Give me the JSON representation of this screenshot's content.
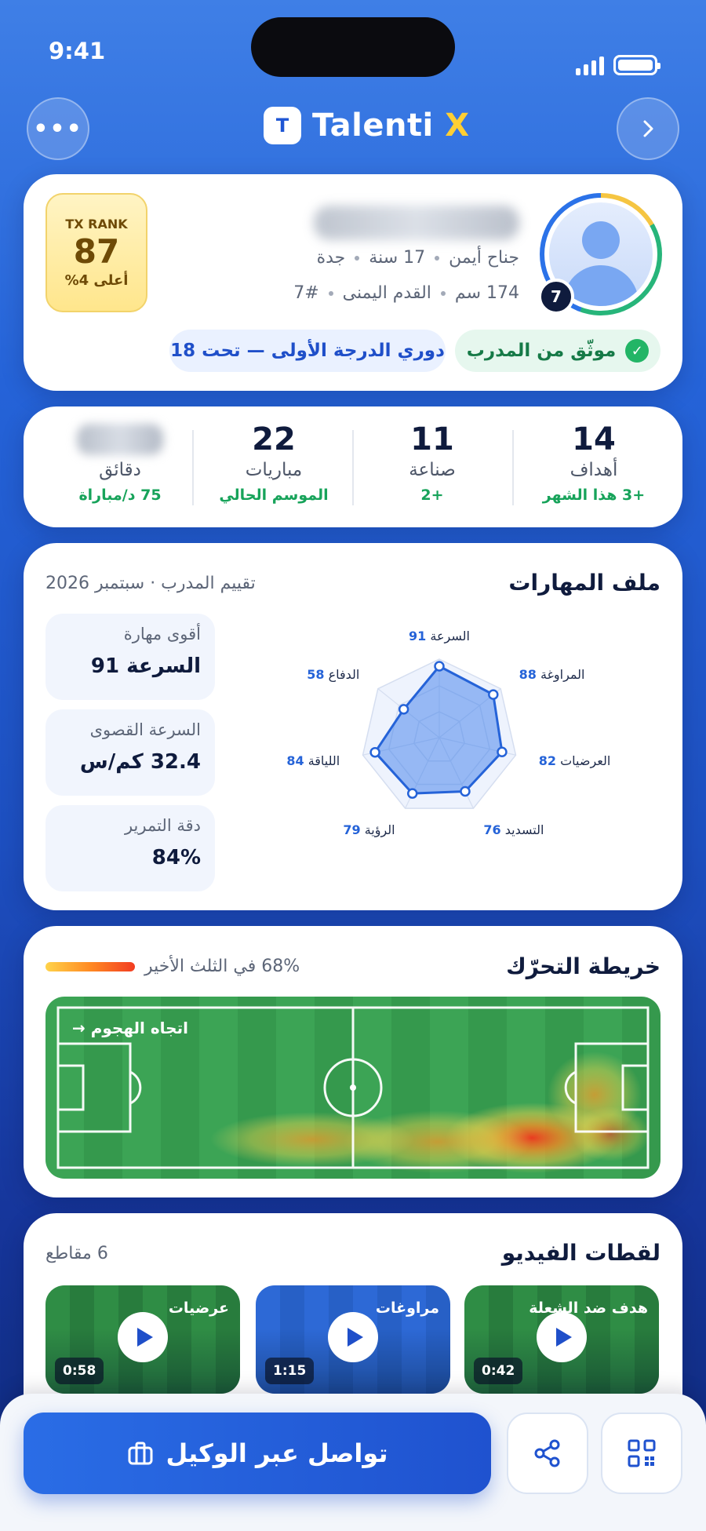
{
  "status": {
    "time": "9:41"
  },
  "header": {
    "brand_initial": "T",
    "brand_name": "Talenti",
    "brand_x": "X"
  },
  "profile": {
    "rank_label": "TX RANK",
    "rank_value": "87",
    "rank_sub": "أعلى 4%",
    "position": "جناح أيمن",
    "age": "17 سنة",
    "city": "جدة",
    "height": "174 سم",
    "foot": "القدم اليمنى",
    "number_text": "#7",
    "jersey": "7",
    "verified": "موثّق من المدرب",
    "league": "دوري الدرجة الأولى — تحت 18"
  },
  "stats": [
    {
      "value": "14",
      "label": "أهداف",
      "sub": "+3 هذا الشهر"
    },
    {
      "value": "11",
      "label": "صناعة",
      "sub": "+2"
    },
    {
      "value": "22",
      "label": "مباريات",
      "sub": "الموسم الحالي"
    },
    {
      "value": "",
      "label": "دقائق",
      "sub": "75 د/مباراة"
    }
  ],
  "skills": {
    "title": "ملف المهارات",
    "subtitle": "تقييم المدرب · سبتمبر 2026",
    "highlights": [
      {
        "label": "أقوى مهارة",
        "value": "السرعة 91"
      },
      {
        "label": "السرعة القصوى",
        "value": "32.4 كم/س"
      },
      {
        "label": "دقة التمرير",
        "value": "84%"
      }
    ],
    "radar": [
      {
        "name": "السرعة",
        "value": 91
      },
      {
        "name": "المراوغة",
        "value": 88
      },
      {
        "name": "العرضيات",
        "value": 82
      },
      {
        "name": "التسديد",
        "value": 76
      },
      {
        "name": "الرؤية",
        "value": 79
      },
      {
        "name": "اللياقة",
        "value": 84
      },
      {
        "name": "الدفاع",
        "value": 58
      }
    ],
    "radar_max": 100
  },
  "heatmap": {
    "title": "خريطة التحرّك",
    "subtitle": "68% في الثلث الأخير",
    "attack_label": "اتجاه الهجوم →"
  },
  "videos": {
    "title": "لقطات الفيديو",
    "count": "6 مقاطع",
    "items": [
      {
        "title": "هدف ضد الشعلة",
        "duration": "0:42",
        "theme": "green"
      },
      {
        "title": "مراوغات",
        "duration": "1:15",
        "theme": "blue"
      },
      {
        "title": "عرضيات",
        "duration": "0:58",
        "theme": "green"
      }
    ]
  },
  "bottom": {
    "cta": "تواصل عبر الوكيل"
  },
  "colors": {
    "primary": "#1f52cf",
    "accent_yellow": "#ffcf33",
    "success": "#22b566"
  }
}
